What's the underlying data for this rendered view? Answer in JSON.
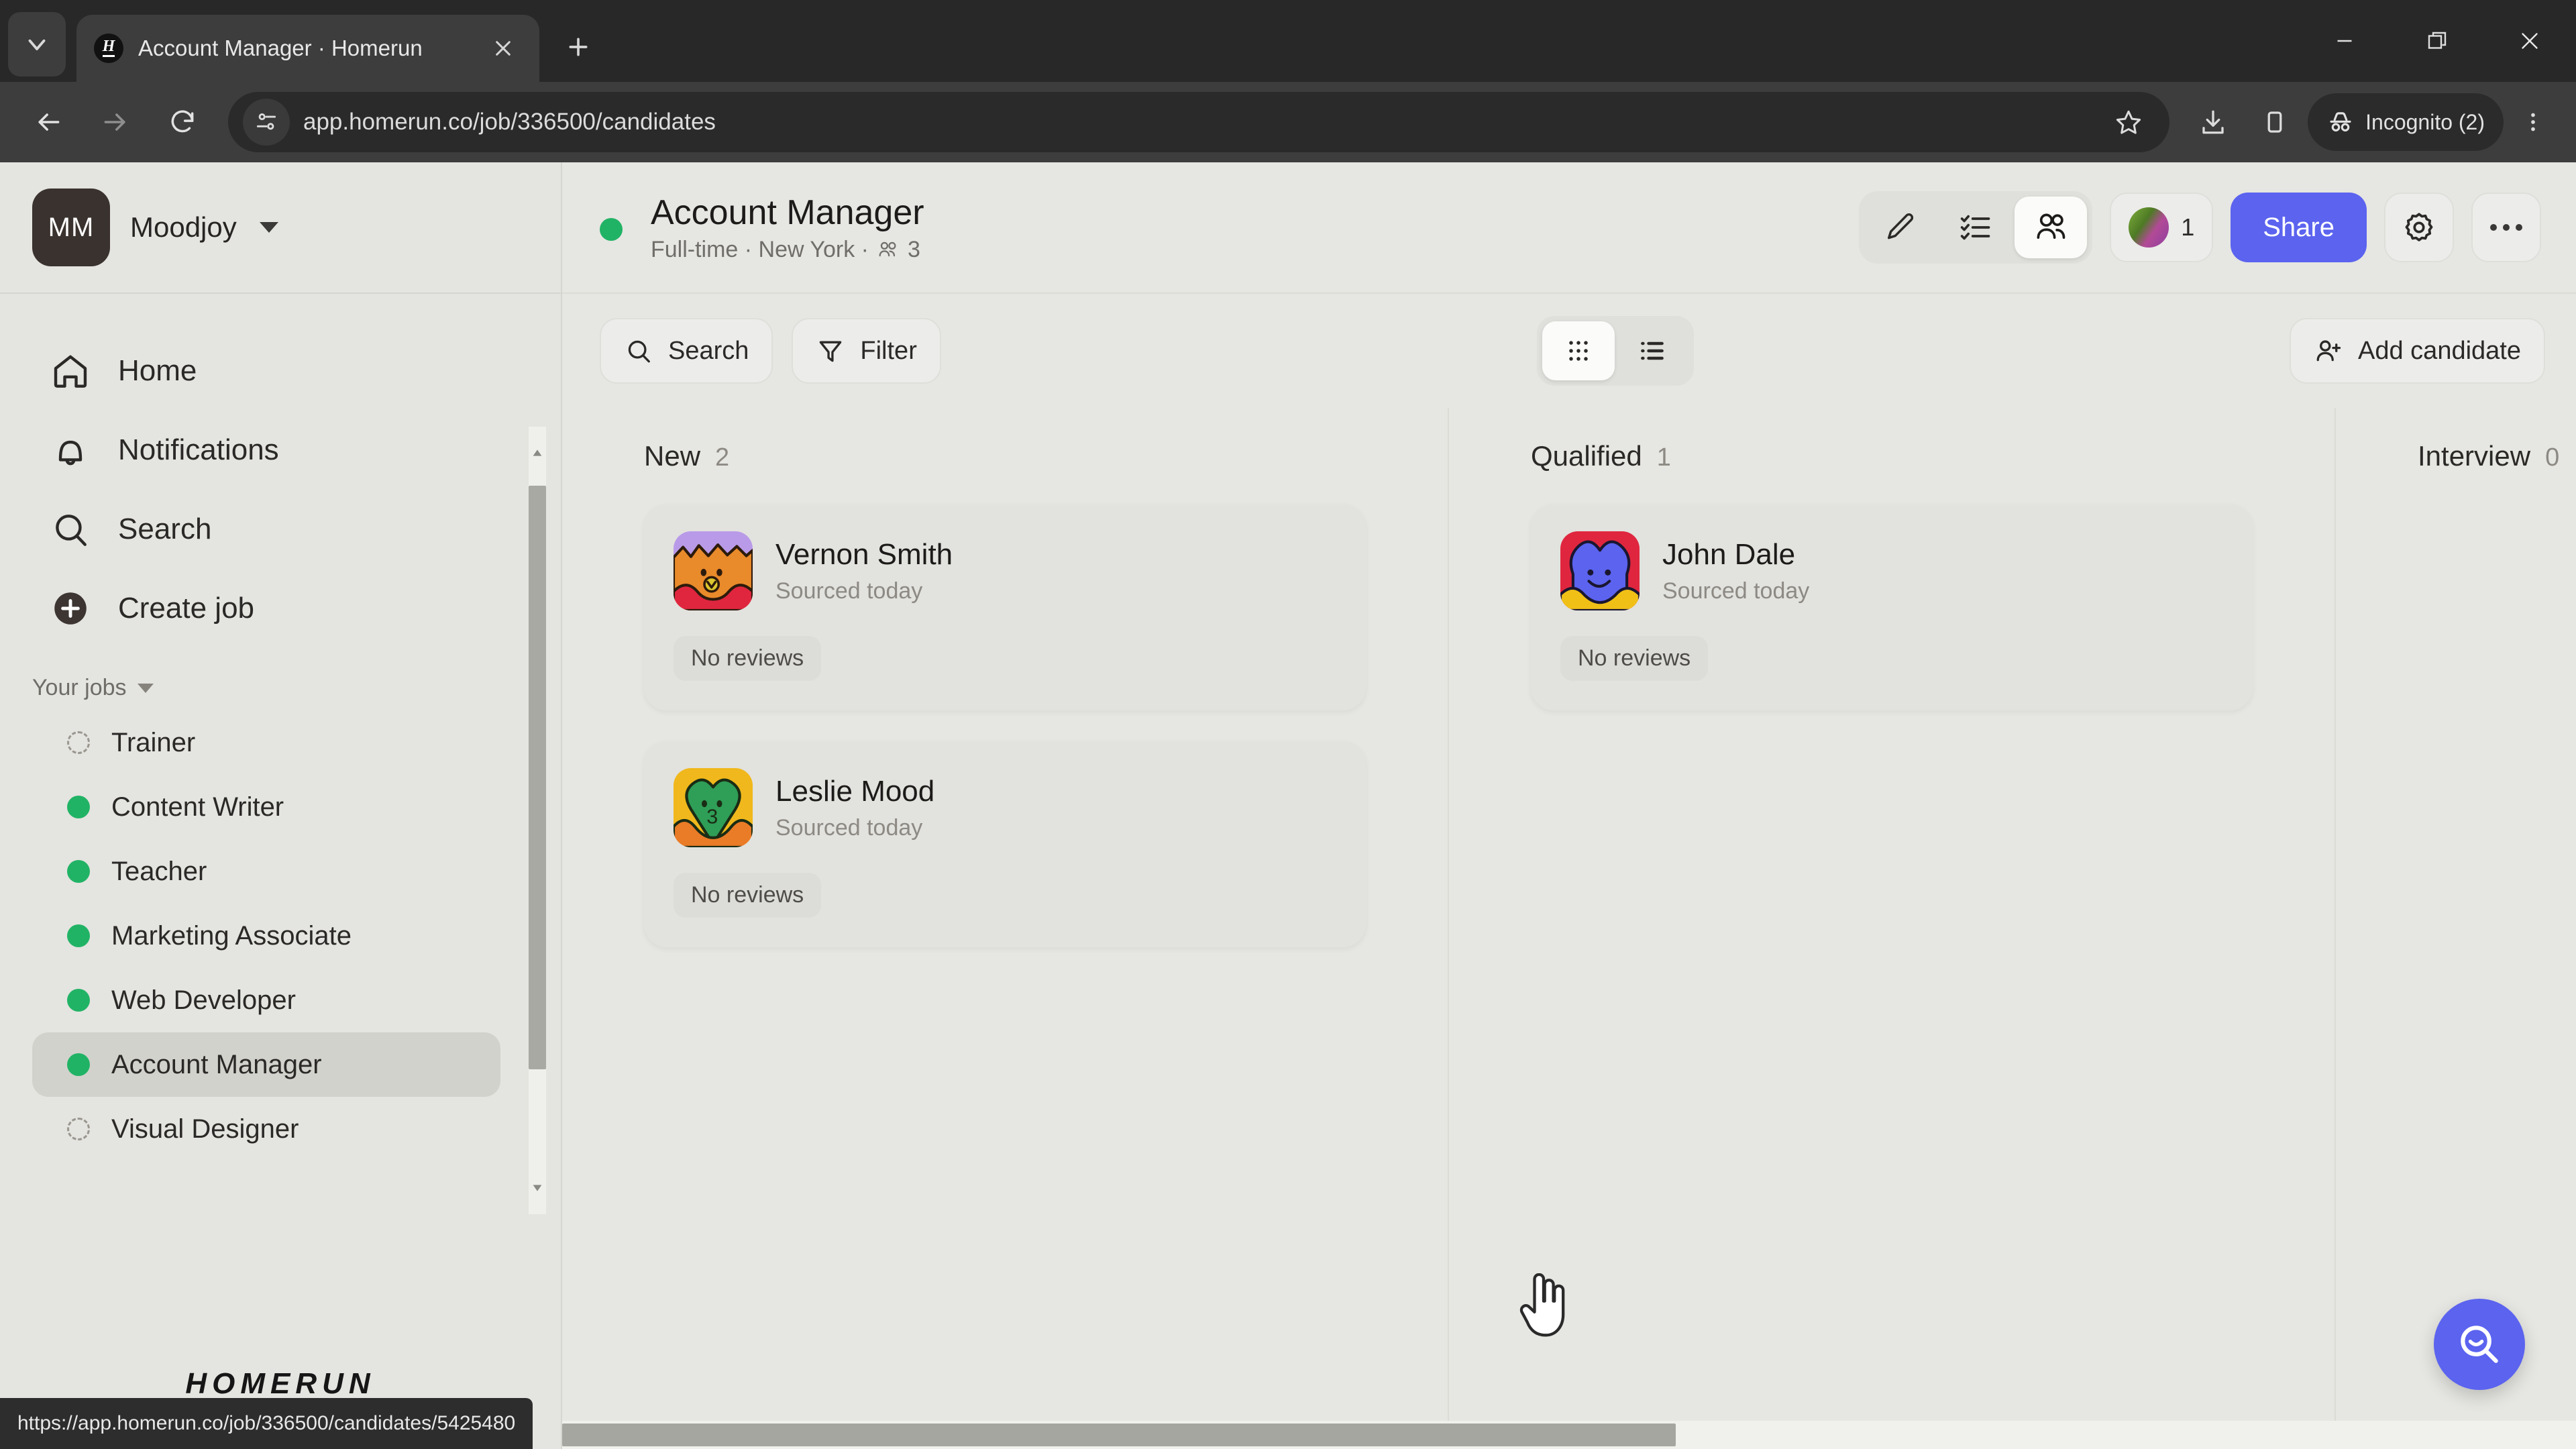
{
  "browser": {
    "tab": {
      "title": "Account Manager · Homerun",
      "favicon_letter": "H"
    },
    "new_tab_label": "+",
    "url": "app.homerun.co/job/336500/candidates",
    "profile_label": "Incognito (2)",
    "status_url": "https://app.homerun.co/job/336500/candidates/5425480",
    "icons": {
      "tab_list": "chevron-down-icon",
      "close_tab": "close-icon",
      "back": "back-arrow-icon",
      "forward": "forward-arrow-icon",
      "reload": "reload-icon",
      "site_info": "site-settings-icon",
      "bookmark": "star-icon",
      "downloads": "download-icon",
      "side_panel": "side-panel-icon",
      "incognito": "incognito-icon",
      "menu": "three-dot-menu-icon",
      "minimize": "minimize-icon",
      "maximize": "restore-icon",
      "close_window": "close-window-icon"
    }
  },
  "sidebar": {
    "org_initials": "MM",
    "org_name": "Moodjoy",
    "nav": [
      {
        "label": "Home",
        "icon": "home-icon"
      },
      {
        "label": "Notifications",
        "icon": "bell-icon"
      },
      {
        "label": "Search",
        "icon": "search-icon"
      },
      {
        "label": "Create job",
        "icon": "plus-circle-icon"
      }
    ],
    "jobs_section_label": "Your jobs",
    "jobs": [
      {
        "label": "Trainer",
        "status": "draft"
      },
      {
        "label": "Content Writer",
        "status": "live"
      },
      {
        "label": "Teacher",
        "status": "live"
      },
      {
        "label": "Marketing Associate",
        "status": "live"
      },
      {
        "label": "Web Developer",
        "status": "live"
      },
      {
        "label": "Account Manager",
        "status": "live",
        "active": true
      },
      {
        "label": "Visual Designer",
        "status": "draft"
      }
    ],
    "footer_logo": "HOMERUN"
  },
  "job_header": {
    "title": "Account Manager",
    "meta": "Full-time · New York · ",
    "team_count": "3",
    "tabs": [
      {
        "name": "edit-job",
        "icon": "pencil-icon",
        "active": false
      },
      {
        "name": "checklist",
        "icon": "checklist-icon",
        "active": false
      },
      {
        "name": "candidates",
        "icon": "people-icon",
        "active": true
      }
    ],
    "collaborators_count": "1",
    "share_label": "Share",
    "settings_icon": "gear-icon",
    "more_icon": "three-dot-menu-icon"
  },
  "board_toolbar": {
    "search_label": "Search",
    "filter_label": "Filter",
    "views": [
      {
        "name": "grid-view",
        "icon": "grid-icon",
        "active": true
      },
      {
        "name": "list-view",
        "icon": "list-icon",
        "active": false
      }
    ],
    "add_candidate_label": "Add candidate"
  },
  "board": {
    "columns": [
      {
        "title": "New",
        "count": "2",
        "cards": [
          {
            "name": "Vernon Smith",
            "sub": "Sourced today",
            "badge": "No reviews",
            "avatar": "vernon"
          },
          {
            "name": "Leslie Mood",
            "sub": "Sourced today",
            "badge": "No reviews",
            "avatar": "leslie"
          }
        ]
      },
      {
        "title": "Qualified",
        "count": "1",
        "cards": [
          {
            "name": "John Dale",
            "sub": "Sourced today",
            "badge": "No reviews",
            "avatar": "john"
          }
        ]
      },
      {
        "title": "Interview",
        "count": "0",
        "cards": []
      }
    ]
  },
  "fab": {
    "icon": "search-smile-icon"
  },
  "colors": {
    "accent": "#5b63ef",
    "status_live": "#21b365",
    "page_bg": "#e6e6e2",
    "sidebar_bg": "#e4e4e0",
    "card_bg": "#e2e2de",
    "chrome_bg": "#3d3d3d",
    "tabstrip_bg": "#282828"
  }
}
